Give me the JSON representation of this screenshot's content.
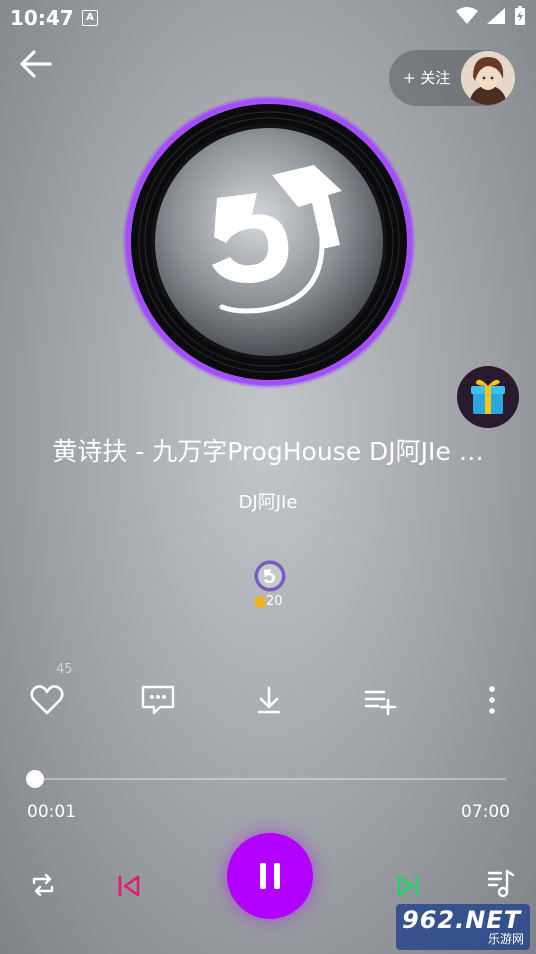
{
  "status": {
    "time": "10:47",
    "notification_glyph": "A",
    "icons": [
      "wifi-icon",
      "signal-icon",
      "battery-charging-icon"
    ]
  },
  "header": {
    "back_icon": "arrow-left-icon",
    "follow_label": "+ 关注"
  },
  "song": {
    "title": "黄诗扶 - 九万字ProgHouse DJ阿JIe …",
    "artist": "DJ阿JIe"
  },
  "uploader": {
    "coin_count": "20"
  },
  "actions": {
    "like_count": "45",
    "items": [
      "heart-icon",
      "comment-icon",
      "download-icon",
      "add-to-playlist-icon",
      "more-icon"
    ]
  },
  "progress": {
    "current": "00:01",
    "total": "07:00",
    "fraction": 0.002
  },
  "controls": [
    "repeat-icon",
    "previous-icon",
    "pause-icon",
    "next-icon",
    "playlist-icon"
  ],
  "watermark": {
    "top": "962.NET",
    "bottom": "乐游网"
  },
  "colors": {
    "accent": "#b100ff",
    "prev": "#e0206a",
    "next": "#22d36a",
    "disc_glow": "#9b3dff"
  }
}
